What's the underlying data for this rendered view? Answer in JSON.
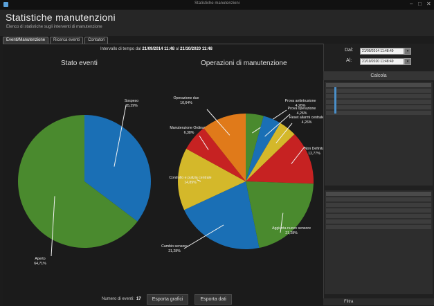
{
  "window": {
    "title": "Statistiche manutenzioni",
    "controls": [
      "–",
      "□",
      "✕"
    ]
  },
  "header": {
    "title": "Statistiche manutenzioni",
    "subtitle": "Elenco di statistiche sugli interventi di manutenzione"
  },
  "tabs": [
    {
      "label": "Eventi/Manutenzione"
    },
    {
      "label": "Ricerca eventi"
    },
    {
      "label": "Contatori"
    }
  ],
  "interval": {
    "label": "Intervallo di tempo dal",
    "from_date": "21/09/2014",
    "from_time": "11:48",
    "to_label": "al",
    "to_date": "21/10/2020",
    "to_time": "11:48"
  },
  "chart_data": [
    {
      "type": "pie",
      "title": "Stato eventi",
      "slices": [
        {
          "label": "Sospeso",
          "value": 35.29,
          "display": "35,29%",
          "color": "#1a6fb5"
        },
        {
          "label": "Aperto",
          "value": 64.71,
          "display": "64,71%",
          "color": "#4a8a2e"
        }
      ]
    },
    {
      "type": "pie",
      "title": "Operazioni di manutenzione",
      "slices": [
        {
          "label": "Prova antintrusione",
          "value": 4.26,
          "display": "4,26%",
          "color": "#4a8a2e"
        },
        {
          "label": "Prova operazione",
          "value": 4.26,
          "display": "4,26%",
          "color": "#1a6fb5"
        },
        {
          "label": "Reset allarmi centrale",
          "value": 4.26,
          "display": "4,26%",
          "color": "#d4b82a"
        },
        {
          "label": "Non Definita",
          "value": 12.77,
          "display": "12,77%",
          "color": "#c62222"
        },
        {
          "label": "Aggiunta nuovo sensore",
          "value": 21.28,
          "display": "21,28%",
          "color": "#4a8a2e"
        },
        {
          "label": "Cambio sensore",
          "value": 21.28,
          "display": "21,28%",
          "color": "#1a6fb5"
        },
        {
          "label": "Controllo e pulizia centrale",
          "value": 14.89,
          "display": "14,89%",
          "color": "#d4b82a"
        },
        {
          "label": "Manutenzione Ordinaria",
          "value": 6.38,
          "display": "6,38%",
          "color": "#c62222"
        },
        {
          "label": "Operazione due",
          "value": 10.64,
          "display": "10,64%",
          "color": "#e07a1a"
        }
      ]
    }
  ],
  "bottom": {
    "events_label": "Numero di eventi:",
    "events_count": "17",
    "export_chart": "Esporta grafici",
    "export_data": "Esporta dati"
  },
  "sidebar": {
    "from_label": "Dal:",
    "from_value": "21/09/2014 11:48:49",
    "to_label": "Al:",
    "to_value": "21/10/2020 11:48:49",
    "calc_label": "Calcola",
    "filter_label": "Filtra"
  }
}
